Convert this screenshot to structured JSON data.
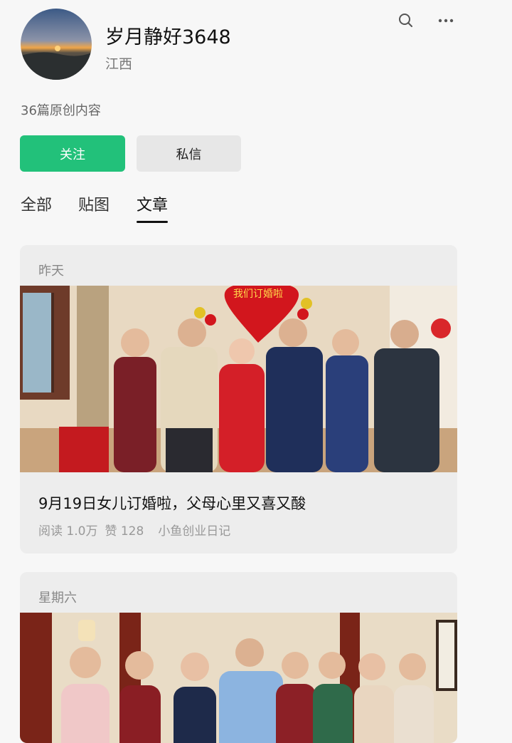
{
  "profile": {
    "name": "岁月静好3648",
    "region": "江西",
    "stats": "36篇原创内容"
  },
  "actions": {
    "follow_label": "关注",
    "message_label": "私信"
  },
  "header_icons": [
    "search-icon",
    "more-icon"
  ],
  "tabs": [
    {
      "label": "全部",
      "active": false
    },
    {
      "label": "贴图",
      "active": false
    },
    {
      "label": "文章",
      "active": true
    }
  ],
  "articles": [
    {
      "date": "昨天",
      "image_banner": "我们订婚啦",
      "title": "9月19日女儿订婚啦，父母心里又喜又酸",
      "reads": "阅读 1.0万",
      "likes": "赞 128",
      "source": "小鱼创业日记"
    },
    {
      "date": "星期六"
    }
  ],
  "colors": {
    "accent": "#22c17a",
    "background": "#f7f7f7",
    "card": "#ededed"
  }
}
